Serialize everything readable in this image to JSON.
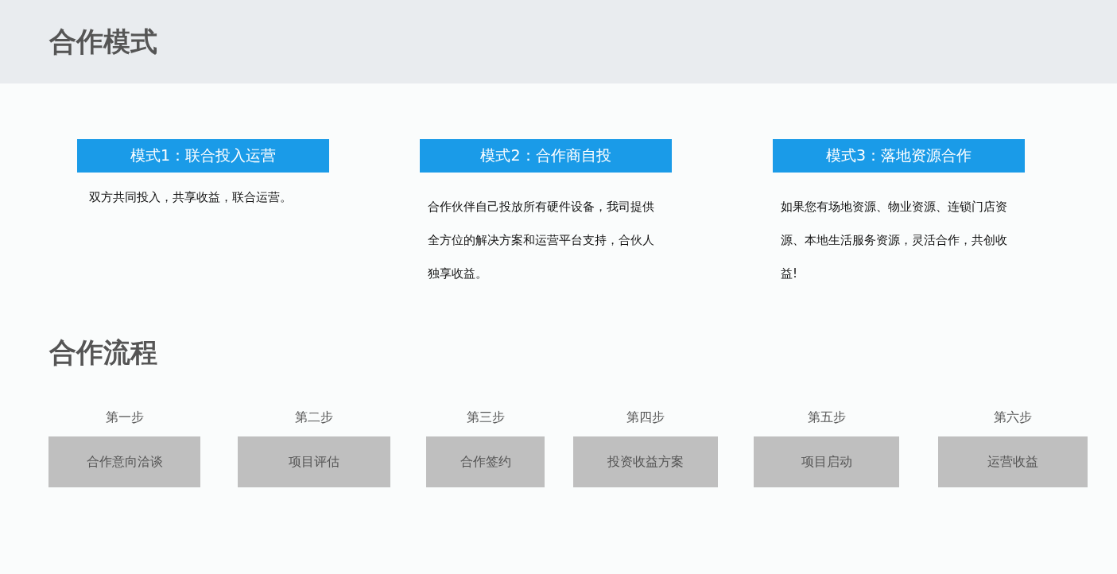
{
  "modes_section": {
    "title": "合作模式",
    "modes": [
      {
        "label": "模式1：联合投入运营",
        "description": "双方共同投入，共享收益，联合运营。"
      },
      {
        "label": "模式2：合作商自投",
        "description": "合作伙伴自己投放所有硬件设备，我司提供全方位的解决方案和运营平台支持，合伙人独享收益。"
      },
      {
        "label": "模式3：落地资源合作",
        "description": "如果您有场地资源、物业资源、连锁门店资源、本地生活服务资源，灵活合作，共创收益!"
      }
    ]
  },
  "process_section": {
    "title": "合作流程",
    "steps": [
      {
        "step": "第一步",
        "name": "合作意向洽谈"
      },
      {
        "step": "第二步",
        "name": "项目评估"
      },
      {
        "step": "第三步",
        "name": "合作签约"
      },
      {
        "step": "第四步",
        "name": "投资收益方案"
      },
      {
        "step": "第五步",
        "name": "项目启动"
      },
      {
        "step": "第六步",
        "name": "运营收益"
      }
    ]
  }
}
